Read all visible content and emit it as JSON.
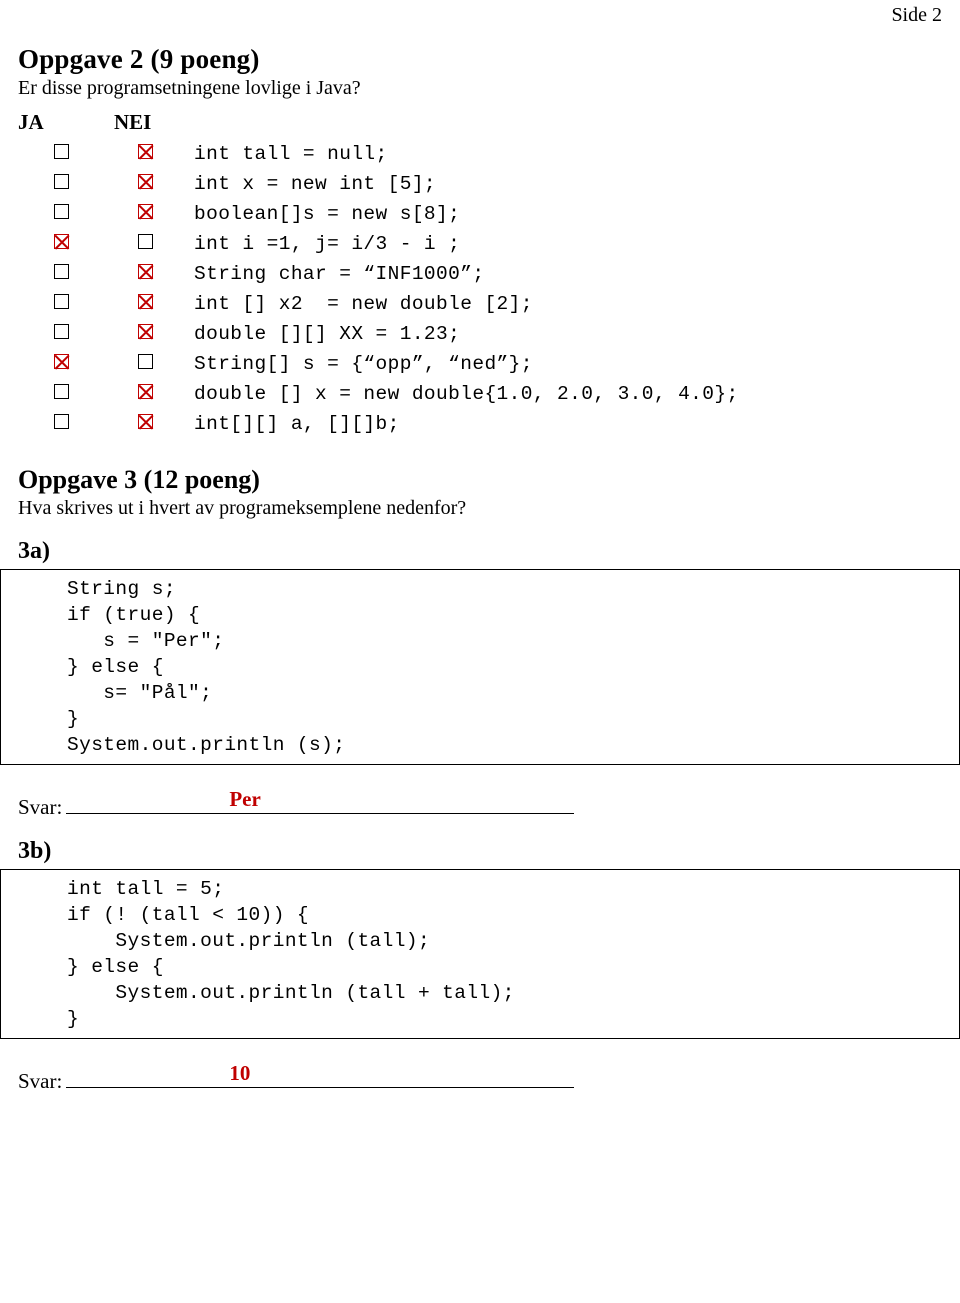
{
  "page": {
    "header_right": "Side 2"
  },
  "task2": {
    "title": "Oppgave 2 (9 poeng)",
    "subtitle": "Er disse programsetningene lovlige i Java?",
    "col_ja": "JA",
    "col_nei": "NEI",
    "rows": [
      {
        "ja": false,
        "nei": true,
        "code": "int tall = null;"
      },
      {
        "ja": false,
        "nei": true,
        "code": "int x = new int [5];"
      },
      {
        "ja": false,
        "nei": true,
        "code": "boolean[]s = new s[8];"
      },
      {
        "ja": true,
        "nei": false,
        "code": "int i =1, j= i/3 - i ;"
      },
      {
        "ja": false,
        "nei": true,
        "code": "String char = “INF1000”;"
      },
      {
        "ja": false,
        "nei": true,
        "code": "int [] x2  = new double [2];"
      },
      {
        "ja": false,
        "nei": true,
        "code": "double [][] XX = 1.23;"
      },
      {
        "ja": true,
        "nei": false,
        "code": "String[] s = {“opp”, “ned”};"
      },
      {
        "ja": false,
        "nei": true,
        "code": "double [] x = new double{1.0, 2.0, 3.0, 4.0};"
      },
      {
        "ja": false,
        "nei": true,
        "code": "int[][] a, [][]b;"
      }
    ]
  },
  "task3": {
    "title": "Oppgave 3 (12 poeng)",
    "subtitle": "Hva skrives ut i hvert av programeksemplene nedenfor?",
    "parts": [
      {
        "label": "3a)",
        "code": "String s;\nif (true) {\n   s = \"Per\";\n} else {\n   s= \"Pål\";\n}\nSystem.out.println (s);",
        "answer_label": "Svar:",
        "answer_value": "Per"
      },
      {
        "label": "3b)",
        "code": "int tall = 5;\nif (! (tall < 10)) {\n    System.out.println (tall);\n} else {\n    System.out.println (tall + tall);\n}",
        "answer_label": "Svar:",
        "answer_value": "10"
      }
    ]
  }
}
